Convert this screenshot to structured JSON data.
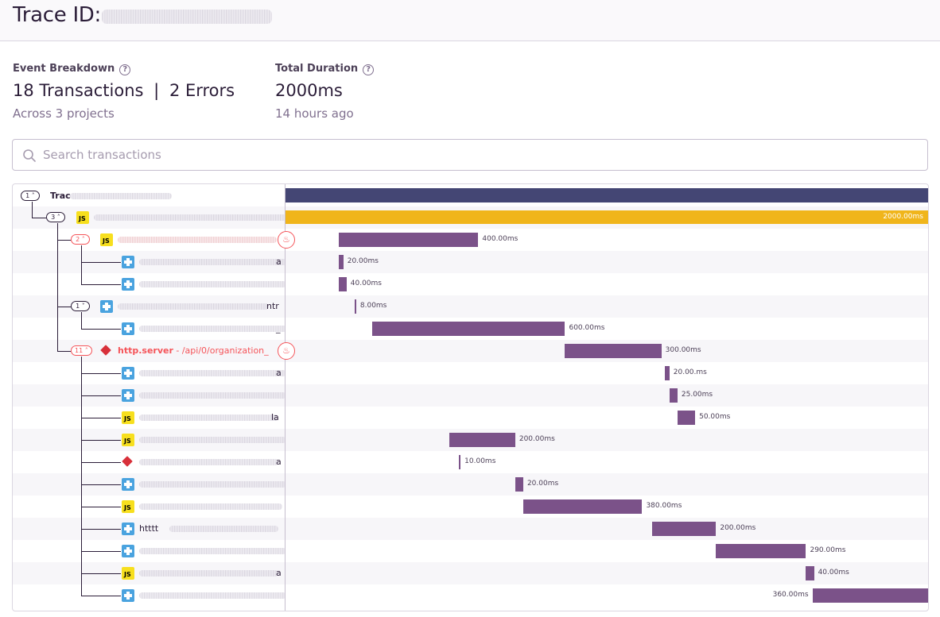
{
  "header": {
    "title": "Trace ID:"
  },
  "stats": {
    "event_breakdown": {
      "label": "Event Breakdown",
      "value_transactions": "18 Transactions",
      "separator": "|",
      "value_errors": "2 Errors",
      "sub": "Across 3 projects"
    },
    "total_duration": {
      "label": "Total Duration",
      "value": "2000ms",
      "sub": "14 hours ago"
    },
    "help_glyph": "?"
  },
  "search": {
    "placeholder": "Search transactions"
  },
  "trace": {
    "root_label": "Trac",
    "colors": {
      "root_bar": "#444674",
      "main_bar": "#f0b51b",
      "span_bar": "#7b5289",
      "error": "#f55459"
    },
    "rows": [
      {
        "badge": "1",
        "project": "",
        "tail": "",
        "op": "",
        "op_desc": "",
        "error": false,
        "start": 0,
        "duration": 1,
        "duration_label": ""
      },
      {
        "badge": "3",
        "project": "JS",
        "tail": "",
        "op": "",
        "op_desc": "",
        "error": false,
        "start": 0,
        "duration": 2000,
        "duration_label": "2000.00ms"
      },
      {
        "badge": "2",
        "project": "JS",
        "tail": "",
        "op": "",
        "op_desc": "",
        "error": true,
        "start": 165,
        "duration": 435,
        "duration_label": "400.00ms"
      },
      {
        "badge": "",
        "project": "python",
        "tail": "a",
        "op": "",
        "op_desc": "",
        "error": false,
        "start": 165,
        "duration": 15,
        "duration_label": "20.00ms"
      },
      {
        "badge": "",
        "project": "python",
        "tail": "",
        "op": "",
        "op_desc": "",
        "error": false,
        "start": 165,
        "duration": 25,
        "duration_label": "40.00ms"
      },
      {
        "badge": "1",
        "project": "python",
        "tail": "ntr",
        "op": "",
        "op_desc": "",
        "error": false,
        "start": 215,
        "duration": 5,
        "duration_label": "8.00ms"
      },
      {
        "badge": "",
        "project": "python",
        "tail": "_",
        "op": "",
        "op_desc": "",
        "error": false,
        "start": 270,
        "duration": 600,
        "duration_label": "600.00ms"
      },
      {
        "badge": "11",
        "project": "ruby",
        "tail": "",
        "op": "http.server",
        "op_desc": " - /api/0/organization_",
        "error": true,
        "start": 870,
        "duration": 300,
        "duration_label": "300.00ms"
      },
      {
        "badge": "",
        "project": "python",
        "tail": "a",
        "op": "",
        "op_desc": "",
        "error": false,
        "start": 1180,
        "duration": 15,
        "duration_label": "20.00.ms"
      },
      {
        "badge": "",
        "project": "python",
        "tail": "",
        "op": "",
        "op_desc": "",
        "error": false,
        "start": 1195,
        "duration": 25,
        "duration_label": "25.00ms"
      },
      {
        "badge": "",
        "project": "JS",
        "tail": "la",
        "op": "",
        "op_desc": "",
        "error": false,
        "start": 1220,
        "duration": 55,
        "duration_label": "50.00ms"
      },
      {
        "badge": "",
        "project": "JS",
        "tail": "",
        "op": "",
        "op_desc": "",
        "error": false,
        "start": 510,
        "duration": 205,
        "duration_label": "200.00ms"
      },
      {
        "badge": "",
        "project": "ruby",
        "tail": "a",
        "op": "",
        "op_desc": "",
        "error": false,
        "start": 540,
        "duration": 5,
        "duration_label": "10.00ms"
      },
      {
        "badge": "",
        "project": "python",
        "tail": "",
        "op": "",
        "op_desc": "",
        "error": false,
        "start": 715,
        "duration": 25,
        "duration_label": "20.00ms"
      },
      {
        "badge": "",
        "project": "JS",
        "tail": "",
        "op": "",
        "op_desc": "",
        "error": false,
        "start": 740,
        "duration": 370,
        "duration_label": "380.00ms"
      },
      {
        "badge": "",
        "project": "python",
        "tail": "htttt",
        "op": "",
        "op_desc": "",
        "error": false,
        "start": 1140,
        "duration": 200,
        "duration_label": "200.00ms"
      },
      {
        "badge": "",
        "project": "python",
        "tail": "",
        "op": "",
        "op_desc": "",
        "error": false,
        "start": 1340,
        "duration": 280,
        "duration_label": "290.00ms"
      },
      {
        "badge": "",
        "project": "JS",
        "tail": "a",
        "op": "",
        "op_desc": "",
        "error": false,
        "start": 1620,
        "duration": 25,
        "duration_label": "40.00ms"
      },
      {
        "badge": "",
        "project": "python",
        "tail": "",
        "op": "",
        "op_desc": "",
        "error": false,
        "start": 1640,
        "duration": 360,
        "duration_label": "360.00ms"
      }
    ]
  }
}
